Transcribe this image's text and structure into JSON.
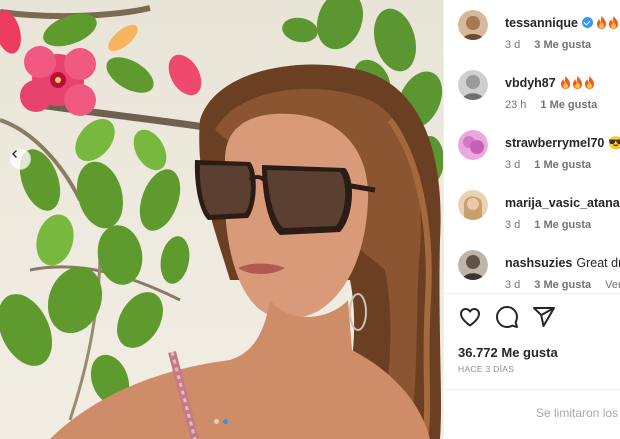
{
  "post": {
    "carousel_dots": 2,
    "active_dot": 1,
    "colors": {
      "accent": "#3897f0",
      "dot_active": "#3a8fe8"
    }
  },
  "comments": [
    {
      "user": "tessannique",
      "text": "",
      "verified": true,
      "fires": 2,
      "time": "3 d",
      "likes": "3 Me gusta",
      "reply": "",
      "avatar": "#a37a55"
    },
    {
      "user": "vbdyh87",
      "text": "",
      "verified": false,
      "fires": 3,
      "time": "23 h",
      "likes": "1 Me gusta",
      "reply": "",
      "avatar": "#9a9a9a"
    },
    {
      "user": "strawberrymel70",
      "text": "😎",
      "verified": false,
      "fires": 0,
      "time": "3 d",
      "likes": "1 Me gusta",
      "reply": "",
      "avatar": "#d477c4"
    },
    {
      "user": "marija_vasic_atanasoski",
      "text": "",
      "verified": false,
      "fires": 0,
      "time": "3 d",
      "likes": "1 Me gusta",
      "reply": "",
      "avatar": "#c9a070"
    },
    {
      "user": "nashsuzies",
      "text": "Great dress",
      "verified": false,
      "fires": 0,
      "time": "3 d",
      "likes": "3 Me gusta",
      "reply": "Ver t",
      "avatar": "#5e5348"
    }
  ],
  "actions": {
    "like_icon": "heart-icon",
    "comment_icon": "comment-icon",
    "share_icon": "share-icon"
  },
  "likes_total": "36.772 Me gusta",
  "posted_ago": "HACE 3 DÍAS",
  "comments_limited": "Se limitaron los"
}
